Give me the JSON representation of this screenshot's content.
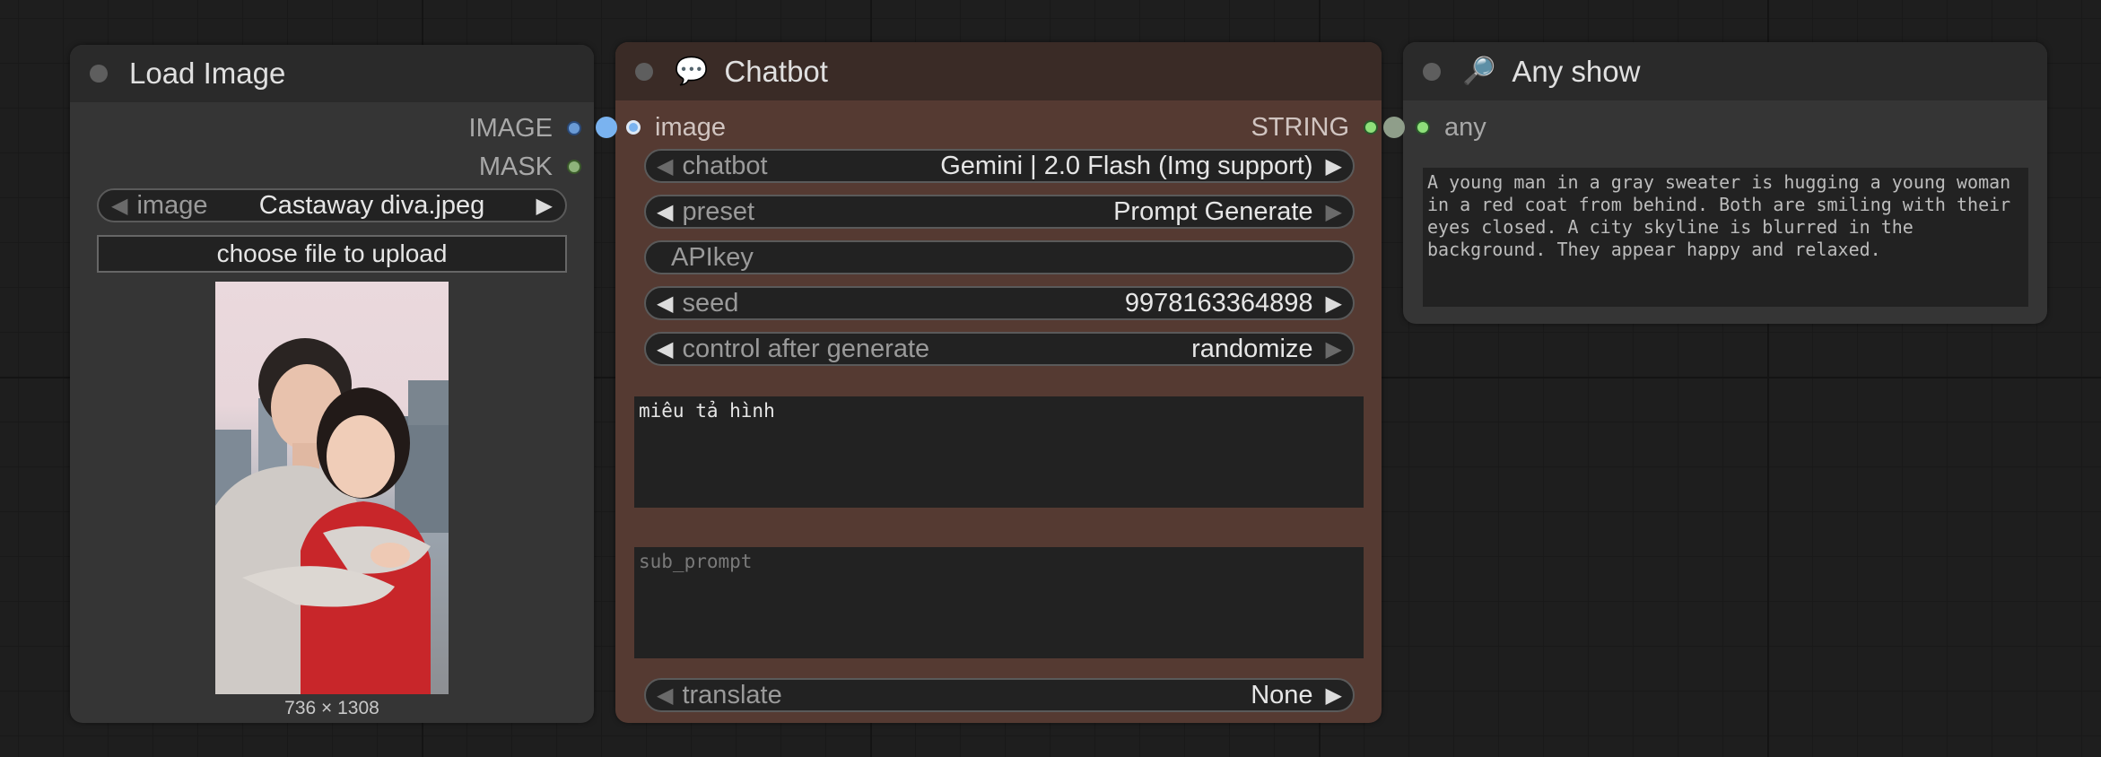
{
  "nodes": {
    "load_image": {
      "title": "Load Image",
      "outputs": [
        "IMAGE",
        "MASK"
      ],
      "image_widget": {
        "label": "image",
        "value": "Castaway diva.jpeg"
      },
      "upload_button": "choose file to upload",
      "dimensions": "736 × 1308"
    },
    "chatbot": {
      "title": "Chatbot",
      "icon": "speech-bubble-icon",
      "input": "image",
      "output": "STRING",
      "widgets": {
        "chatbot": {
          "label": "chatbot",
          "value": "Gemini | 2.0 Flash (Img support)"
        },
        "preset": {
          "label": "preset",
          "value": "Prompt Generate"
        },
        "apikey": {
          "label": "APIkey"
        },
        "seed": {
          "label": "seed",
          "value": "9978163364898"
        },
        "control": {
          "label": "control after generate",
          "value": "randomize"
        },
        "translate": {
          "label": "translate",
          "value": "None"
        }
      },
      "prompt_text": "miêu tả hình",
      "sub_prompt_placeholder": "sub_prompt"
    },
    "any_show": {
      "title": "Any show",
      "icon": "magnifier-icon",
      "input": "any",
      "text": "A young man in a gray sweater is hugging a young woman in a red coat from behind. Both are smiling with their eyes closed. A city skyline is blurred in the background. They appear happy and relaxed."
    }
  },
  "colors": {
    "image_link": "#7ab3f0",
    "mask_slot": "#8eb37a",
    "string_link": "#8ee07a",
    "chatbot_title_bg": "#3a2b26",
    "chatbot_body_bg": "#553a32",
    "node_bg": "#353535",
    "node_title_bg": "#2a2a2a"
  }
}
